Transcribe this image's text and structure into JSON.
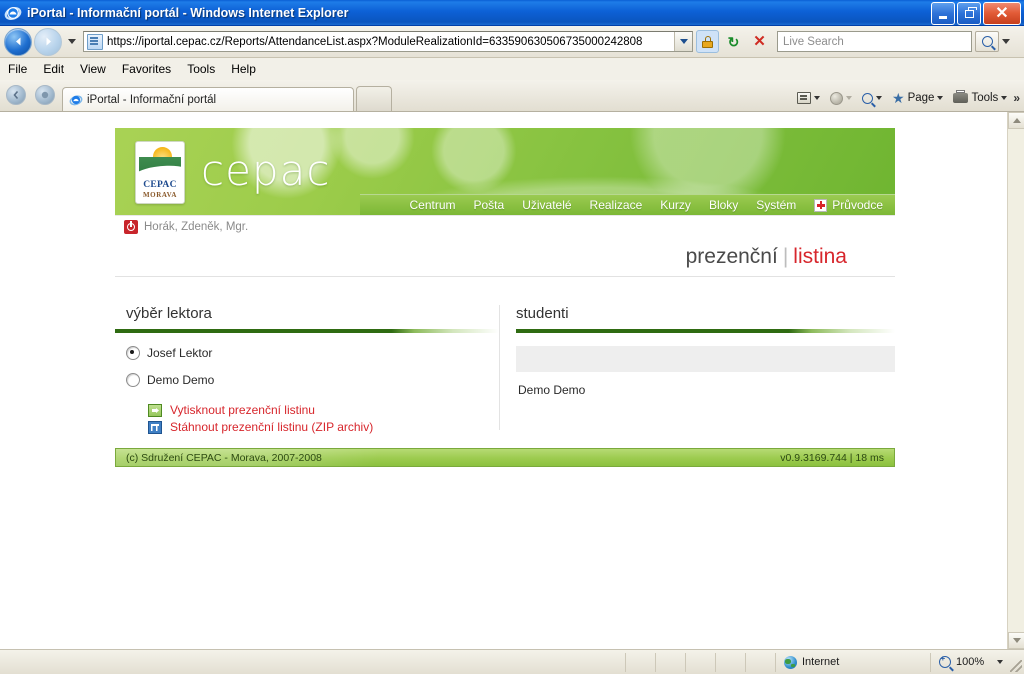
{
  "window": {
    "title": "iPortal - Informační portál - Windows Internet Explorer",
    "minimize_label": "",
    "restore_label": "",
    "close_label": "✕"
  },
  "address_bar": {
    "url": "https://iportal.cepac.cz/Reports/AttendanceList.aspx?ModuleRealizationId=633590630506735000242808",
    "back_label": "◀",
    "forward_label": "▶",
    "refresh_label": "↻",
    "stop_label": "✕",
    "search_placeholder": "Live Search"
  },
  "menu": {
    "items": [
      "File",
      "Edit",
      "View",
      "Favorites",
      "Tools",
      "Help"
    ]
  },
  "tabs": {
    "items": [
      {
        "label": "iPortal - Informační portál"
      }
    ]
  },
  "command_bar": {
    "page_label": "Page",
    "tools_label": "Tools",
    "overflow_label": "»"
  },
  "site": {
    "brand": "cepac",
    "logo": {
      "name": "CEPAC",
      "region": "MORAVA"
    },
    "nav": [
      {
        "label": "Centrum"
      },
      {
        "label": "Pošta"
      },
      {
        "label": "Uživatelé"
      },
      {
        "label": "Realizace"
      },
      {
        "label": "Kurzy"
      },
      {
        "label": "Bloky"
      },
      {
        "label": "Systém"
      },
      {
        "label": "Průvodce",
        "icon": "red-cross-icon"
      }
    ],
    "user": "Horák, Zdeněk, Mgr.",
    "page_title": {
      "first": "prezenční",
      "separator": "|",
      "second": "listina"
    },
    "left_panel": {
      "heading": "výběr lektora",
      "options": [
        {
          "label": "Josef Lektor",
          "selected": true
        },
        {
          "label": "Demo Demo",
          "selected": false
        }
      ],
      "actions": [
        {
          "label": "Vytisknout prezenční listinu",
          "icon": "print-export-icon"
        },
        {
          "label": "Stáhnout prezenční listinu (ZIP archiv)",
          "icon": "table-download-icon"
        }
      ]
    },
    "right_panel": {
      "heading": "studenti",
      "header_row": "",
      "rows": [
        {
          "label": "Demo Demo"
        }
      ]
    },
    "footer": {
      "copyright": "(c) Sdružení CEPAC - Morava, 2007-2008",
      "version": "v0.9.3169.744 | 18 ms"
    }
  },
  "status_bar": {
    "zone": "Internet",
    "zoom": "100%"
  },
  "colors": {
    "brand_green": "#8cc143",
    "accent_red": "#d7262c",
    "rule_dark_green": "#2f6b12",
    "title_blue": "#0d61d6"
  }
}
